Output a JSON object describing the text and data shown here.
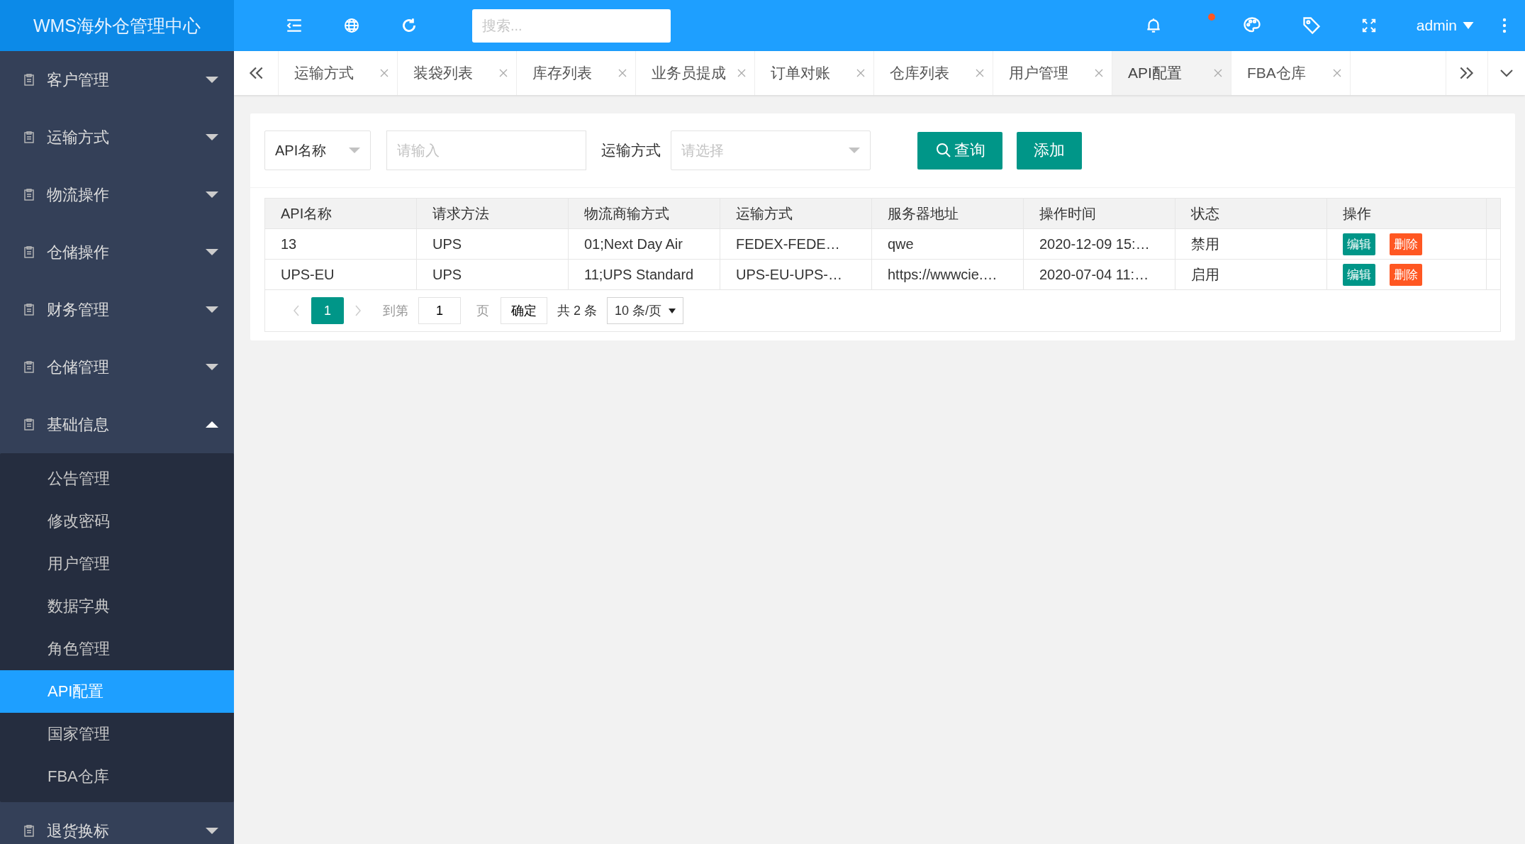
{
  "sidebar": {
    "logo": "WMS海外仓管理中心",
    "menu": [
      {
        "label": "客户管理",
        "expanded": false
      },
      {
        "label": "运输方式",
        "expanded": false
      },
      {
        "label": "物流操作",
        "expanded": false
      },
      {
        "label": "仓储操作",
        "expanded": false
      },
      {
        "label": "财务管理",
        "expanded": false
      },
      {
        "label": "仓储管理",
        "expanded": false
      },
      {
        "label": "基础信息",
        "expanded": true,
        "children": [
          {
            "label": "公告管理",
            "selected": false
          },
          {
            "label": "修改密码",
            "selected": false
          },
          {
            "label": "用户管理",
            "selected": false
          },
          {
            "label": "数据字典",
            "selected": false
          },
          {
            "label": "角色管理",
            "selected": false
          },
          {
            "label": "API配置",
            "selected": true
          },
          {
            "label": "国家管理",
            "selected": false
          },
          {
            "label": "FBA仓库",
            "selected": false
          }
        ]
      },
      {
        "label": "退货换标",
        "expanded": false
      }
    ]
  },
  "header": {
    "search": {
      "placeholder": "搜索..."
    },
    "notification_dot": true,
    "user": "admin"
  },
  "tabs": [
    {
      "label": "运输方式",
      "selected": false
    },
    {
      "label": "装袋列表",
      "selected": false
    },
    {
      "label": "库存列表",
      "selected": false
    },
    {
      "label": "业务员提成",
      "selected": false
    },
    {
      "label": "订单对账",
      "selected": false
    },
    {
      "label": "仓库列表",
      "selected": false
    },
    {
      "label": "用户管理",
      "selected": false
    },
    {
      "label": "API配置",
      "selected": true
    },
    {
      "label": "FBA仓库",
      "selected": false
    }
  ],
  "filter": {
    "field_select": "API名称",
    "keyword": {
      "placeholder": "请输入"
    },
    "shipping_label": "运输方式",
    "shipping_select": {
      "placeholder": "请选择"
    },
    "buttons": [
      {
        "label": "查询",
        "kind": "search"
      },
      {
        "label": "添加",
        "kind": "plain"
      }
    ]
  },
  "table": {
    "columns": [
      "API名称",
      "请求方法",
      "物流商输方式",
      "运输方式",
      "服务器地址",
      "操作时间",
      "状态",
      "操作"
    ],
    "rows": [
      {
        "cells": [
          "13",
          "UPS",
          "01;Next Day Air",
          "FEDEX-FEDE…",
          "qwe",
          "2020-12-09 15:…",
          "禁用"
        ],
        "actions": [
          {
            "label": "编辑",
            "kind": "edit"
          },
          {
            "label": "删除",
            "kind": "delete"
          }
        ]
      },
      {
        "cells": [
          "UPS-EU",
          "UPS",
          "11;UPS Standard",
          "UPS-EU-UPS-…",
          "https://wwwcie.…",
          "2020-07-04 11:…",
          "启用"
        ],
        "actions": [
          {
            "label": "编辑",
            "kind": "edit"
          },
          {
            "label": "删除",
            "kind": "delete"
          }
        ]
      }
    ]
  },
  "pagination": {
    "pages": [
      {
        "label": "1",
        "selected": true
      }
    ],
    "goto_label": "到第",
    "page_input": "1",
    "page_unit": "页",
    "confirm": "确定",
    "total": "共 2 条",
    "page_size": "10 条/页"
  }
}
